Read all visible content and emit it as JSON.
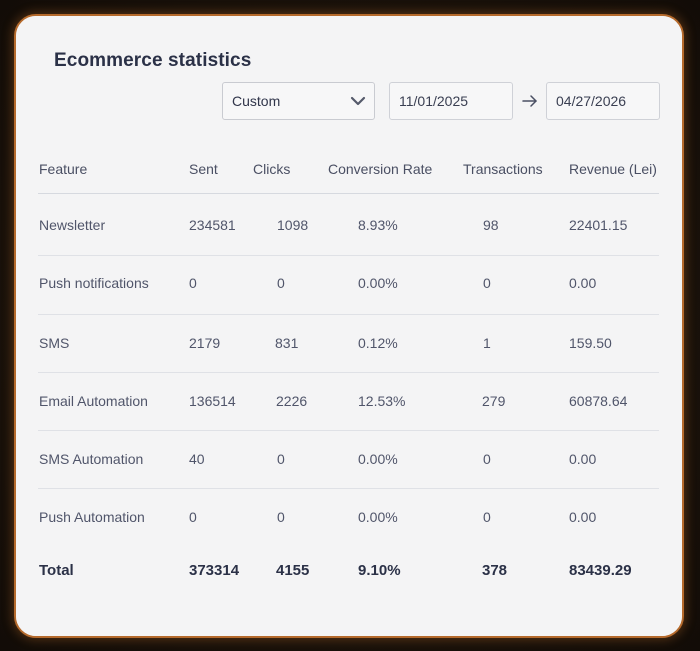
{
  "title": "Ecommerce statistics",
  "filters": {
    "range_select": "Custom",
    "date_from": "11/01/2025",
    "date_to": "04/27/2026"
  },
  "columns": [
    "Feature",
    "Sent",
    "Clicks",
    "Conversion Rate",
    "Transactions",
    "Revenue (Lei)"
  ],
  "rows": [
    [
      "Newsletter",
      "234581",
      "1098",
      "8.93%",
      "98",
      "22401.15"
    ],
    [
      "Push notifications",
      "0",
      "0",
      "0.00%",
      "0",
      "0.00"
    ],
    [
      "SMS",
      "2179",
      "831",
      "0.12%",
      "1",
      "159.50"
    ],
    [
      "Email Automation",
      "136514",
      "2226",
      "12.53%",
      "279",
      "60878.64"
    ],
    [
      "SMS Automation",
      "40",
      "0",
      "0.00%",
      "0",
      "0.00"
    ],
    [
      "Push Automation",
      "0",
      "0",
      "0.00%",
      "0",
      "0.00"
    ]
  ],
  "totals": [
    "Total",
    "373314",
    "4155",
    "9.10%",
    "378",
    "83439.29"
  ],
  "colors": {
    "accent_border": "#b56a2c",
    "card_bg": "#f4f4f5",
    "heading_text": "#2b3147"
  },
  "icons": {
    "select_caret": "chevron-down-icon",
    "range_separator": "arrow-right-icon"
  }
}
